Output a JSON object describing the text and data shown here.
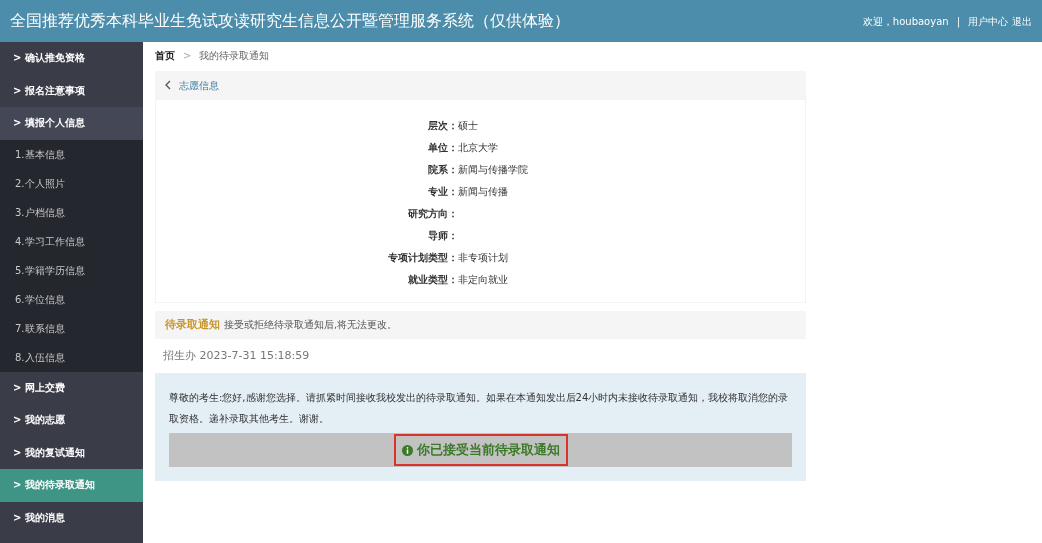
{
  "header": {
    "title": "全国推荐优秀本科毕业生免试攻读研究生信息公开暨管理服务系统（仅供体验）",
    "welcome": "欢迎，houbaoyan",
    "separator": "|",
    "links": [
      "用户中心",
      "退出"
    ]
  },
  "sidebar": {
    "items": [
      {
        "label": "> 确认推免资格",
        "selected": false
      },
      {
        "label": "> 报名注意事项",
        "selected": false
      },
      {
        "label": "> 填报个人信息",
        "selected": false,
        "expanded": true,
        "children": [
          {
            "label": "1.基本信息"
          },
          {
            "label": "2.个人照片"
          },
          {
            "label": "3.户档信息"
          },
          {
            "label": "4.学习工作信息"
          },
          {
            "label": "5.学籍学历信息"
          },
          {
            "label": "6.学位信息"
          },
          {
            "label": "7.联系信息"
          },
          {
            "label": "8.入伍信息"
          }
        ]
      },
      {
        "label": "> 网上交费",
        "selected": false
      },
      {
        "label": "> 我的志愿",
        "selected": false
      },
      {
        "label": "> 我的复试通知",
        "selected": false
      },
      {
        "label": "> 我的待录取通知",
        "selected": true
      },
      {
        "label": "> 我的消息",
        "selected": false
      }
    ]
  },
  "breadcrumb": [
    "首页",
    "我的待录取通知"
  ],
  "breadcrumb_separator": ">",
  "volunteer_panel": {
    "back_label": "志愿信息",
    "fields": [
      {
        "label": "层次：",
        "value": "硕士"
      },
      {
        "label": "单位：",
        "value": "北京大学"
      },
      {
        "label": "院系：",
        "value": "新闻与传播学院"
      },
      {
        "label": "专业：",
        "value": "新闻与传播"
      },
      {
        "label": "研究方向："
      },
      {
        "label": "导师："
      },
      {
        "label": "专项计划类型：",
        "value": "非专项计划"
      },
      {
        "label": "就业类型：",
        "value": "非定向就业"
      }
    ]
  },
  "notice_panel": {
    "title": "待录取通知",
    "hint": "接受或拒绝待录取通知后,将无法更改。",
    "sender": "招生办 2023-7-31 15:18:59",
    "message": "尊敬的考生:您好,感谢您选择。请抓紧时间接收我校发出的待录取通知。如果在本通知发出后24小时内未接收待录取通知，我校将取消您的录取资格。递补录取其他考生。谢谢。",
    "status": "你已接受当前待录取通知",
    "highlighted": true
  }
}
